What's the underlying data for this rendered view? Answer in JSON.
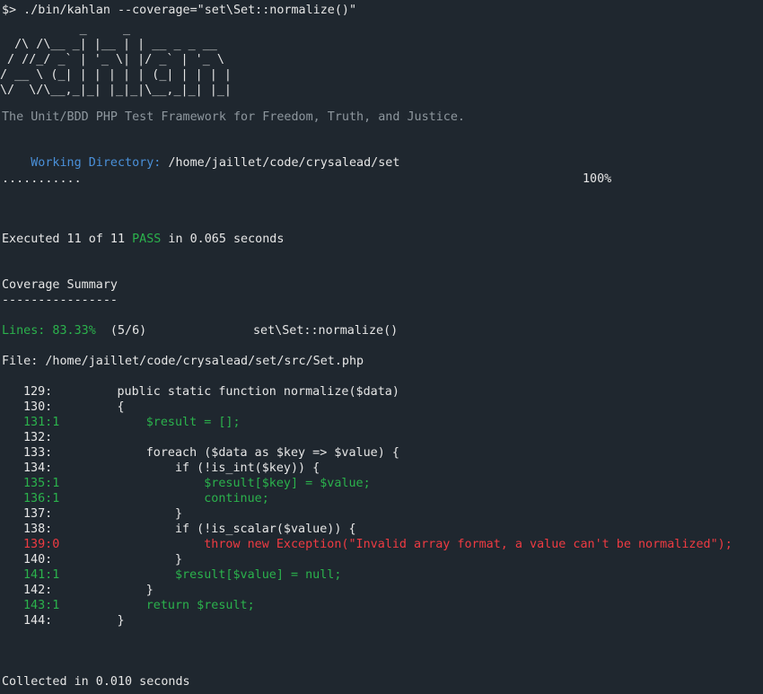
{
  "command": "$> ./bin/kahlan --coverage=\"set\\Set::normalize()\"",
  "ascii_logo": "           _     _\n  /\\ /\\__ _| |__ | | __ _ _ __\n / //_/ _` | '_ \\| |/ _` | '_ \\\n/ __ \\ (_| | | | | | (_| | | | |\n\\/  \\/\\__,_|_| |_|_|\\__,_|_| |_|",
  "tagline": "The Unit/BDD PHP Test Framework for Freedom, Truth, and Justice.",
  "working_dir_label": "Working Directory:",
  "working_dir_value": "/home/jaillet/code/crysalead/set",
  "progress_dots": "...........",
  "progress_percent": "100%",
  "executed": {
    "prefix": "Executed 11 of 11 ",
    "status": "PASS",
    "suffix": " in 0.065 seconds"
  },
  "coverage_title": "Coverage Summary",
  "coverage_rule": "----------------",
  "lines_label": "Lines: 83.33%",
  "lines_count": "  (5/6)",
  "lines_target": "set\\Set::normalize()",
  "file_line": "File: /home/jaillet/code/crysalead/set/src/Set.php",
  "source": [
    {
      "num": "129:",
      "code": "        public static function normalize($data)",
      "status": "neutral"
    },
    {
      "num": "130:",
      "code": "        {",
      "status": "neutral"
    },
    {
      "num": "131:1",
      "code": "            $result = [];",
      "status": "covered"
    },
    {
      "num": "132:",
      "code": "",
      "status": "neutral"
    },
    {
      "num": "133:",
      "code": "            foreach ($data as $key => $value) {",
      "status": "neutral"
    },
    {
      "num": "134:",
      "code": "                if (!is_int($key)) {",
      "status": "neutral"
    },
    {
      "num": "135:1",
      "code": "                    $result[$key] = $value;",
      "status": "covered"
    },
    {
      "num": "136:1",
      "code": "                    continue;",
      "status": "covered"
    },
    {
      "num": "137:",
      "code": "                }",
      "status": "neutral"
    },
    {
      "num": "138:",
      "code": "                if (!is_scalar($value)) {",
      "status": "neutral"
    },
    {
      "num": "139:0",
      "code": "                    throw new Exception(\"Invalid array format, a value can't be normalized\");",
      "status": "uncovered"
    },
    {
      "num": "140:",
      "code": "                }",
      "status": "neutral"
    },
    {
      "num": "141:1",
      "code": "                $result[$value] = null;",
      "status": "covered"
    },
    {
      "num": "142:",
      "code": "            }",
      "status": "neutral"
    },
    {
      "num": "143:1",
      "code": "            return $result;",
      "status": "covered"
    },
    {
      "num": "144:",
      "code": "        }",
      "status": "neutral"
    }
  ],
  "collected": "Collected in 0.010 seconds",
  "colors": {
    "background": "#1f272f",
    "text": "#e6e6e6",
    "dim": "#8e979e",
    "blue": "#4a90d9",
    "green": "#2bb24c",
    "red": "#ef3b42"
  }
}
